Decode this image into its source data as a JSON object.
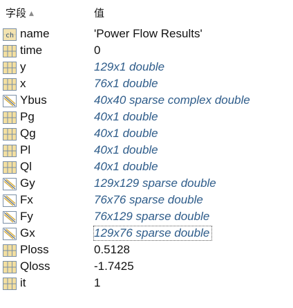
{
  "header": {
    "field_label": "字段",
    "sort_icon": "sort-ascending-icon",
    "value_label": "值"
  },
  "rows": [
    {
      "icon": "char-array-icon",
      "name": "name",
      "value": "'Power Flow Results'",
      "italic": false
    },
    {
      "icon": "numeric-array-icon",
      "name": "time",
      "value": "0",
      "italic": false
    },
    {
      "icon": "numeric-array-icon",
      "name": "y",
      "value": "129x1 double",
      "italic": true
    },
    {
      "icon": "numeric-array-icon",
      "name": "x",
      "value": "76x1 double",
      "italic": true
    },
    {
      "icon": "sparse-matrix-icon",
      "name": "Ybus",
      "value": "40x40 sparse complex double",
      "italic": true
    },
    {
      "icon": "numeric-array-icon",
      "name": "Pg",
      "value": "40x1 double",
      "italic": true
    },
    {
      "icon": "numeric-array-icon",
      "name": "Qg",
      "value": "40x1 double",
      "italic": true
    },
    {
      "icon": "numeric-array-icon",
      "name": "Pl",
      "value": "40x1 double",
      "italic": true
    },
    {
      "icon": "numeric-array-icon",
      "name": "Ql",
      "value": "40x1 double",
      "italic": true
    },
    {
      "icon": "sparse-matrix-icon",
      "name": "Gy",
      "value": "129x129 sparse double",
      "italic": true
    },
    {
      "icon": "sparse-matrix-icon",
      "name": "Fx",
      "value": "76x76 sparse double",
      "italic": true
    },
    {
      "icon": "sparse-matrix-icon",
      "name": "Fy",
      "value": "76x129 sparse double",
      "italic": true
    },
    {
      "icon": "sparse-matrix-icon",
      "name": "Gx",
      "value": "129x76 sparse double",
      "italic": true,
      "selected": true
    },
    {
      "icon": "numeric-array-icon",
      "name": "Ploss",
      "value": "0.5128",
      "italic": false
    },
    {
      "icon": "numeric-array-icon",
      "name": "Qloss",
      "value": "-1.7425",
      "italic": false
    },
    {
      "icon": "numeric-array-icon",
      "name": "it",
      "value": "1",
      "italic": false
    }
  ],
  "colors": {
    "icon_border": "#7a8fa6",
    "icon_fill": "#e8c56a",
    "italic_text": "#2e5c8a"
  }
}
